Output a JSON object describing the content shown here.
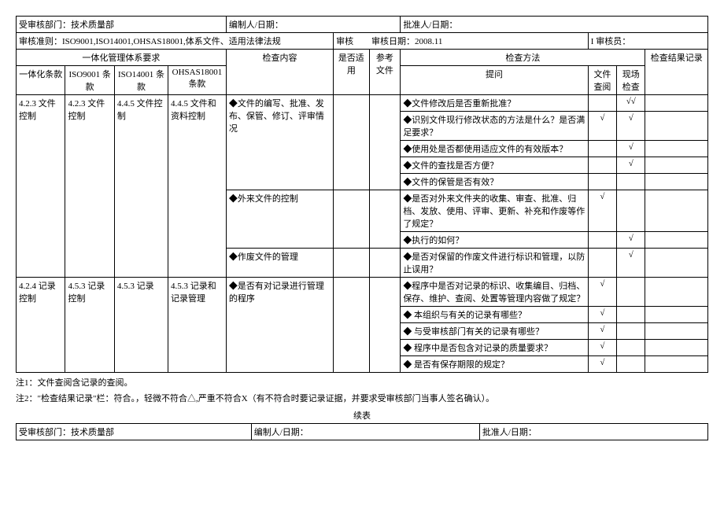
{
  "header": {
    "dept_label": "受审核部门：",
    "dept_value": "技术质量部",
    "preparer_label": "编制人/日期：",
    "approver_label": "批准人/日期：",
    "criteria_label": "审核准则：",
    "criteria_value": "ISO9001,ISO14001,OHSAS18001,体系文件、适用法律法规",
    "audit_date_label": "审核日期：",
    "audit_mid_label": "审核",
    "audit_date_value": "2008.11",
    "auditor_label": "审核员：",
    "auditor_prefix": "I"
  },
  "thead": {
    "group1": "一体化管理体系要求",
    "col_int": "一体化条款",
    "col_iso9": "ISO9001\n条款",
    "col_iso14": "ISO14001\n条款",
    "col_ohsas": "OHSAS18001\n条款",
    "col_content": "检查内容",
    "col_apply": "是否适用",
    "col_ref": "参考文件",
    "group2": "检查方法",
    "col_question": "提问",
    "col_docrev": "文件查阅",
    "col_site": "现场检查",
    "col_result": "检查结果记录"
  },
  "rows": [
    {
      "int": "4.2.3 文件控制",
      "iso9": "4.2.3 文件控制",
      "iso14": "4.4.5 文件控制",
      "ohsas": "4.4.5 文件和资料控制",
      "blocks": [
        {
          "content": "◆文件的编写、批准、发布、保管、修订、评审情况",
          "questions": [
            {
              "q": "◆文件修改后是否重新批准？",
              "doc": "",
              "site": "√√"
            },
            {
              "q": "◆识别文件现行修改状态的方法是什么？是否满足要求？",
              "doc": "√",
              "site": "√"
            },
            {
              "q": "◆使用处是否都使用适应文件的有效版本？",
              "doc": "",
              "site": "√"
            },
            {
              "q": "◆文件的查找是否方便？",
              "doc": "",
              "site": "√"
            },
            {
              "q": "◆文件的保管是否有效？",
              "doc": "",
              "site": ""
            }
          ]
        },
        {
          "content": "◆外来文件的控制",
          "questions": [
            {
              "q": "◆是否对外来文件夹的收集、审查、批准、归档、发放、使用、评审、更新、补充和作废等作了规定？",
              "doc": "√",
              "site": ""
            },
            {
              "q": "◆执行的如何？",
              "doc": "",
              "site": "√"
            }
          ]
        },
        {
          "content": "◆作废文件的管理",
          "questions": [
            {
              "q": "◆是否对保留的作废文件进行标识和管理，以防止误用？",
              "doc": "",
              "site": "√"
            }
          ]
        }
      ]
    },
    {
      "int": "4.2.4 记录控制",
      "iso9": "4.5.3 记录控制",
      "iso14": "4.5.3\n记录",
      "ohsas": "4.5.3\n记录和记录管理",
      "blocks": [
        {
          "content": "◆是否有对记录进行管理的程序",
          "questions": [
            {
              "q": "◆程序中是否对记录的标识、收集编目、归档、保存、维护、查阅、处置等管理内容做了规定？",
              "doc": "√",
              "site": ""
            },
            {
              "q": "◆ 本组织与有关的记录有哪些？",
              "doc": "√",
              "site": ""
            },
            {
              "q": "◆ 与受审核部门有关的记录有哪些？",
              "doc": "√",
              "site": ""
            },
            {
              "q": "◆ 程序中是否包含对记录的质量要求？",
              "doc": "√",
              "site": ""
            },
            {
              "q": "◆ 是否有保存期限的规定？",
              "doc": "√",
              "site": ""
            }
          ]
        }
      ]
    }
  ],
  "notes": {
    "n1": "注1：文件查阅含记录的查阅。",
    "n2": "注2：\"检查结果记录\"栏：符合。，轻微不符合△,严重不符合X（有不符合时要记录证据，并要求受审核部门当事人签名确认）。"
  },
  "cont": "续表",
  "footer": {
    "dept_label": "受审核部门：",
    "dept_value": "技术质量部",
    "preparer_label": "编制人/日期：",
    "approver_label": "批准人/日期："
  }
}
